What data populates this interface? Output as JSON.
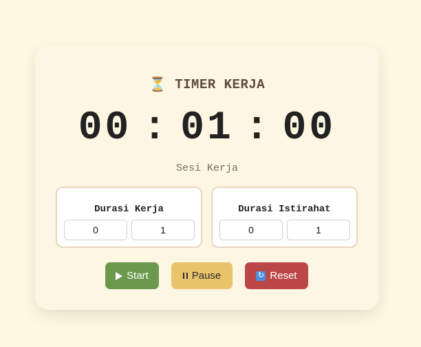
{
  "header": {
    "icon": "hourglass-icon",
    "title": "TIMER KERJA"
  },
  "timer": {
    "hours": "00",
    "minutes": "01",
    "seconds": "00",
    "separator": ":",
    "session_label": "Sesi Kerja"
  },
  "settings": {
    "work": {
      "label": "Durasi Kerja",
      "value_a": "0",
      "value_b": "1"
    },
    "break": {
      "label": "Durasi Istirahat",
      "value_a": "0",
      "value_b": "1"
    }
  },
  "controls": {
    "start_label": "Start",
    "start_icon": "play-icon",
    "pause_label": "Pause",
    "pause_icon": "pause-icon",
    "reset_label": "Reset",
    "reset_icon": "reset-icon"
  },
  "colors": {
    "background": "#fff8e1",
    "card": "#fdf6e3",
    "start": "#6a994e",
    "pause": "#e9c46a",
    "reset": "#bc4749",
    "panel_border": "#e8d6bf"
  }
}
